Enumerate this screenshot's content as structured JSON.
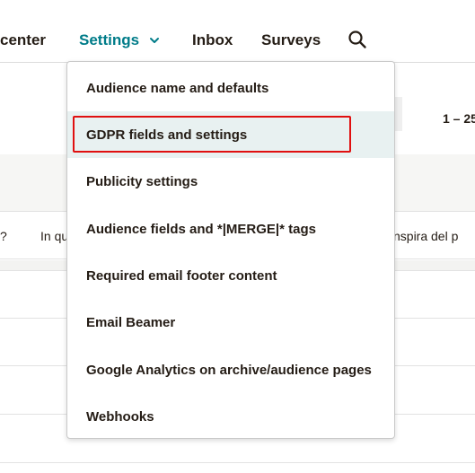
{
  "nav": {
    "items": [
      {
        "label": "center"
      },
      {
        "label": "Settings",
        "active": true
      },
      {
        "label": "Inbox"
      },
      {
        "label": "Surveys"
      }
    ],
    "dropdown_icon": "chevron-down-icon",
    "search_icon": "search-icon",
    "accent_color": "#007c89"
  },
  "background": {
    "pager": "1 – 25",
    "row_text_left": "?",
    "row_text_mid": "In qu",
    "row_text_right": "ti inspira del p"
  },
  "menu": {
    "items": [
      {
        "label": "Audience name and defaults"
      },
      {
        "label": "GDPR fields and settings",
        "highlighted": true
      },
      {
        "label": "Publicity settings"
      },
      {
        "label": "Audience fields and *|MERGE|* tags"
      },
      {
        "label": "Required email footer content"
      },
      {
        "label": "Email Beamer"
      },
      {
        "label": "Google Analytics on archive/audience pages"
      },
      {
        "label": "Webhooks"
      }
    ],
    "highlight_color": "#e8f1f1",
    "annotation_color": "#e01010"
  }
}
